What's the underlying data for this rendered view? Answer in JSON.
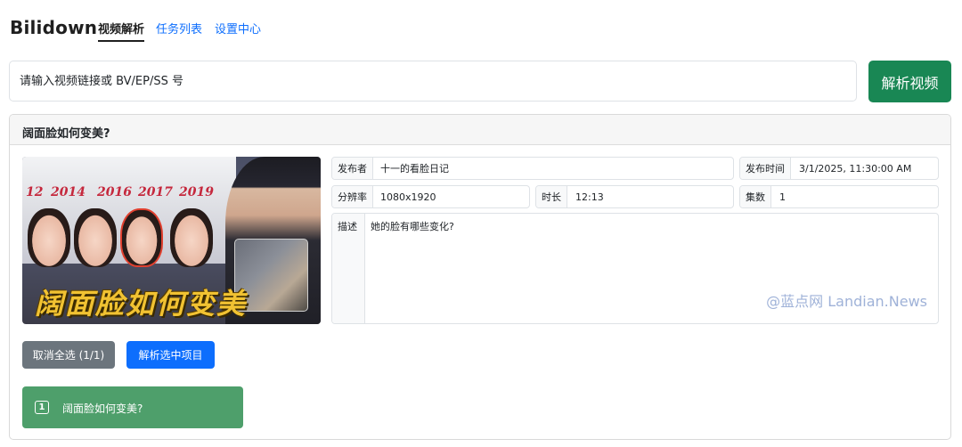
{
  "app": {
    "brand": "Bilidown",
    "tabs": [
      {
        "label": "视频解析",
        "active": true
      },
      {
        "label": "任务列表",
        "active": false
      },
      {
        "label": "设置中心",
        "active": false
      }
    ]
  },
  "search": {
    "placeholder": "请输入视频链接或 BV/EP/SS 号",
    "button_label": "解析视频"
  },
  "video": {
    "title": "阔面脸如何变美?",
    "thumbnail": {
      "years": [
        "12",
        "2014",
        "2016",
        "2017",
        "2019"
      ],
      "caption": "阔面脸如何变美"
    },
    "fields": {
      "publisher_label": "发布者",
      "publisher_value": "十一的看脸日记",
      "publish_time_label": "发布时间",
      "publish_time_value": "3/1/2025, 11:30:00 AM",
      "resolution_label": "分辨率",
      "resolution_value": "1080x1920",
      "duration_label": "时长",
      "duration_value": "12:13",
      "episodes_label": "集数",
      "episodes_value": "1",
      "description_label": "描述",
      "description_value": "她的脸有哪些变化?"
    },
    "watermark": "@蓝点网 Landian.News"
  },
  "actions": {
    "deselect_label": "取消全选 (1/1)",
    "parse_selected_label": "解析选中项目"
  },
  "episodes": [
    {
      "index": "1",
      "title": "阔面脸如何变美?"
    }
  ],
  "colors": {
    "primary": "#0d6efd",
    "success": "#198754",
    "secondary": "#6c757d",
    "episode_selected": "#4e9f6b"
  }
}
